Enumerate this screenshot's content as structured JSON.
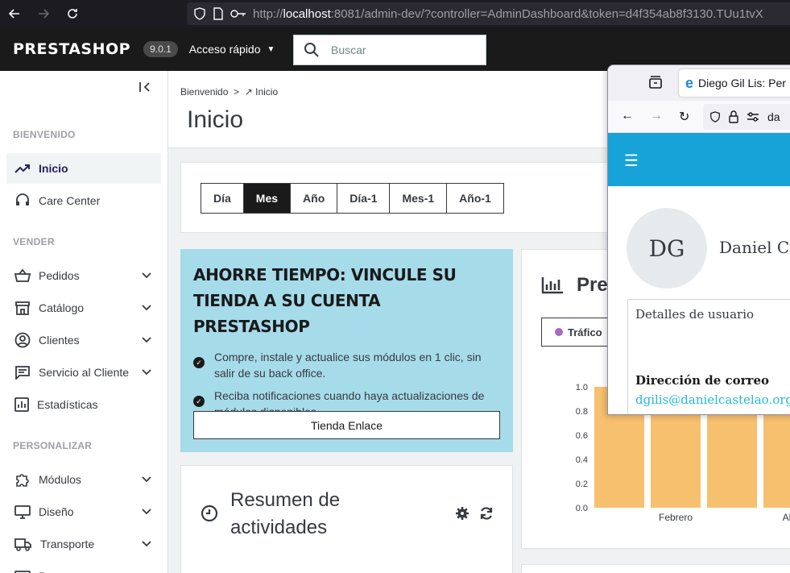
{
  "browser": {
    "url_scheme": "http://",
    "url_host": "localhost",
    "url_rest": ":8081/admin-dev/?controller=AdminDashboard&token=d4f354ab8f3130.TUu1tvX"
  },
  "header": {
    "logo": "PRESTASHOP",
    "version": "9.0.1",
    "quick_access": "Acceso rápido",
    "search_placeholder": "Buscar"
  },
  "sidebar": {
    "sections": [
      "BIENVENIDO",
      "VENDER",
      "PERSONALIZAR"
    ],
    "items": [
      {
        "label": "Inicio",
        "icon": "trending-up-icon"
      },
      {
        "label": "Care Center",
        "icon": "headset-icon"
      },
      {
        "label": "Pedidos",
        "icon": "basket-icon"
      },
      {
        "label": "Catálogo",
        "icon": "store-icon"
      },
      {
        "label": "Clientes",
        "icon": "account-circle-icon"
      },
      {
        "label": "Servicio al Cliente",
        "icon": "chat-icon"
      },
      {
        "label": "Estadísticas",
        "icon": "bar-chart-icon"
      },
      {
        "label": "Módulos",
        "icon": "puzzle-icon"
      },
      {
        "label": "Diseño",
        "icon": "monitor-icon"
      },
      {
        "label": "Transporte",
        "icon": "truck-icon"
      },
      {
        "label": "P",
        "icon": "card-icon"
      }
    ]
  },
  "main": {
    "breadcrumb": {
      "root": "Bienvenido",
      "sep": ">",
      "current": "Inicio"
    },
    "title": "Inicio",
    "periods": [
      "Día",
      "Mes",
      "Año",
      "Día-1",
      "Mes-1",
      "Año-1"
    ],
    "selected_period": "Mes",
    "promo": {
      "title": "AHORRE TIEMPO: VINCULE SU TIENDA A SU CUENTA PRESTASHOP",
      "bullets": [
        "Compre, instale y actualice sus módulos en 1 clic, sin salir de su back office.",
        "Reciba notificaciones cuando haya actualizaciones de módulos disponibles."
      ],
      "button": "Tienda Enlace"
    },
    "activity": {
      "title": "Resumen de actividades"
    },
    "chart_card": {
      "title": "Prev",
      "legend": "Tráfico"
    }
  },
  "chart_data": {
    "type": "bar",
    "categories": [
      "",
      "Febrero",
      "",
      "Ab"
    ],
    "values": [
      1.0,
      1.0,
      1.0,
      1.0
    ],
    "ylim": [
      0,
      1.0
    ],
    "yticks": [
      "0.0",
      "0.2",
      "0.4",
      "0.6",
      "0.8",
      "1.0"
    ],
    "bar_color": "#f6b95e"
  },
  "popup": {
    "tab_title": "Diego Gil Lis: Per",
    "address": "da",
    "initials": "DG",
    "user_name": "Daniel C",
    "details_title": "Detalles de usuario",
    "email_label": "Dirección de correo",
    "email": "dgilis@danielcastelao.org"
  }
}
